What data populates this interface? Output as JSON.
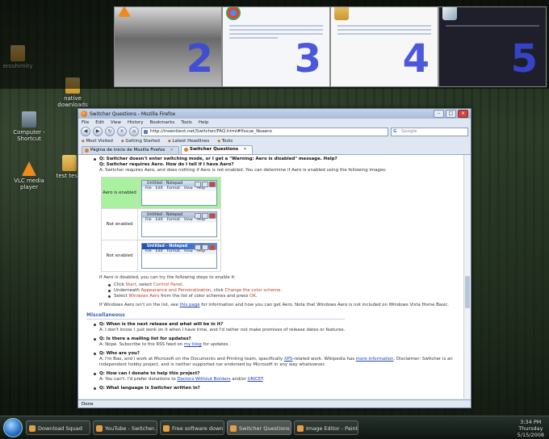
{
  "desktop_icons": [
    {
      "label": "eroshimity"
    },
    {
      "label": "native downloads"
    },
    {
      "label": "Computer - Shortcut"
    },
    {
      "label": "VLC media player"
    },
    {
      "label": "test tests"
    }
  ],
  "switcher": {
    "thumbs": [
      {
        "num": "2"
      },
      {
        "num": "3"
      },
      {
        "num": "4"
      },
      {
        "num": "5"
      }
    ]
  },
  "browser": {
    "title": "Switcher Questions - Mozilla Firefox",
    "menu": [
      "File",
      "Edit",
      "View",
      "History",
      "Bookmarks",
      "Tools",
      "Help"
    ],
    "url": "http://insentient.net/Switcher/FAQ.html#fIssue_Noaero",
    "search_placeholder": "Google",
    "bookmarks": [
      "Most Visited",
      "Getting Started",
      "Latest Headlines",
      "Tools"
    ],
    "tabs": [
      {
        "label": "Página de inicio de Mozilla Firefox"
      },
      {
        "label": "Switcher Questions"
      }
    ],
    "status": "Done"
  },
  "faq": {
    "q1": "Q: Switcher doesn't enter switching mode, or I get a \"Warning: Aero is disabled\" message. Help?",
    "q2": "Q: Switcher requires Aero. How do I tell if I have Aero?",
    "a2": "A: Switcher requires Aero, and does nothing if Aero is not enabled. You can determine if Aero is enabled using the following images:",
    "aero_rows": [
      {
        "label": "Aero is enabled"
      },
      {
        "label": "Not enabled"
      },
      {
        "label": "Not enabled"
      }
    ],
    "notepad_title": "Untitled - Notepad",
    "notepad_menu": [
      "File",
      "Edit",
      "Format",
      "View",
      "Help"
    ],
    "aero_steps_intro": "If Aero is disabled, you can try the following steps to enable it:",
    "steps": [
      {
        "pre": "Click ",
        "hl": "Start",
        "post": ", select ",
        "hl2": "Control Panel",
        "post2": "."
      },
      {
        "pre": "Underneath ",
        "hl": "Appearance and Personalization",
        "post": ", click ",
        "hl2": "Change the color scheme",
        "post2": "."
      },
      {
        "pre": "Select ",
        "hl": "Windows Aero",
        "post": " from the list of color schemes and press ",
        "hl2": "OK",
        "post2": "."
      }
    ],
    "aero_note_pre": "If Windows Aero isn't on the list, see ",
    "aero_note_link": "this page",
    "aero_note_post": " for information and how you can get Aero. Note that Windows Aero is not included on Windows Vista Home Basic.",
    "misc_title": "Miscellaneous",
    "misc": [
      {
        "q": "Q: When is the next release and what will be in it?",
        "a": "A: I don't know. I just work on it when I have time, and I'd rather not make promises of release dates or features."
      },
      {
        "q": "Q: Is there a mailing list for updates?",
        "a_pre": "A: Nope. Subscribe to the RSS feed on ",
        "a_link": "my blog",
        "a_post": " for updates."
      },
      {
        "q": "Q: Who are you?",
        "a_pre": "A: I'm Bao, and I work at Microsoft on the Documents and Printing team, specifically ",
        "a_link": "XPS",
        "a_post": "-related work. Wikipedia has ",
        "a_link2": "more information",
        "a_post2": ". Disclaimer: Switcher is an independent hobby project, and is neither supported nor endorsed by Microsoft in any way whatsoever."
      },
      {
        "q": "Q: How can I donate to help this project?",
        "a_pre": "A: You can't. I'd prefer donations to ",
        "a_link": "Doctors Without Borders",
        "a_post": " and/or ",
        "a_link2": "UNICEF",
        "a_post2": "."
      },
      {
        "q": "Q: What language is Switcher written in?"
      }
    ]
  },
  "taskbar": {
    "buttons": [
      {
        "label": "Download Squad"
      },
      {
        "label": "YouTube - Switcher..."
      },
      {
        "label": "Free software down..."
      },
      {
        "label": "Switcher Questions ..."
      },
      {
        "label": "Image Editor - Paint..."
      }
    ],
    "time": "3:34 PM",
    "day": "Thursday",
    "date": "5/15/2008"
  }
}
